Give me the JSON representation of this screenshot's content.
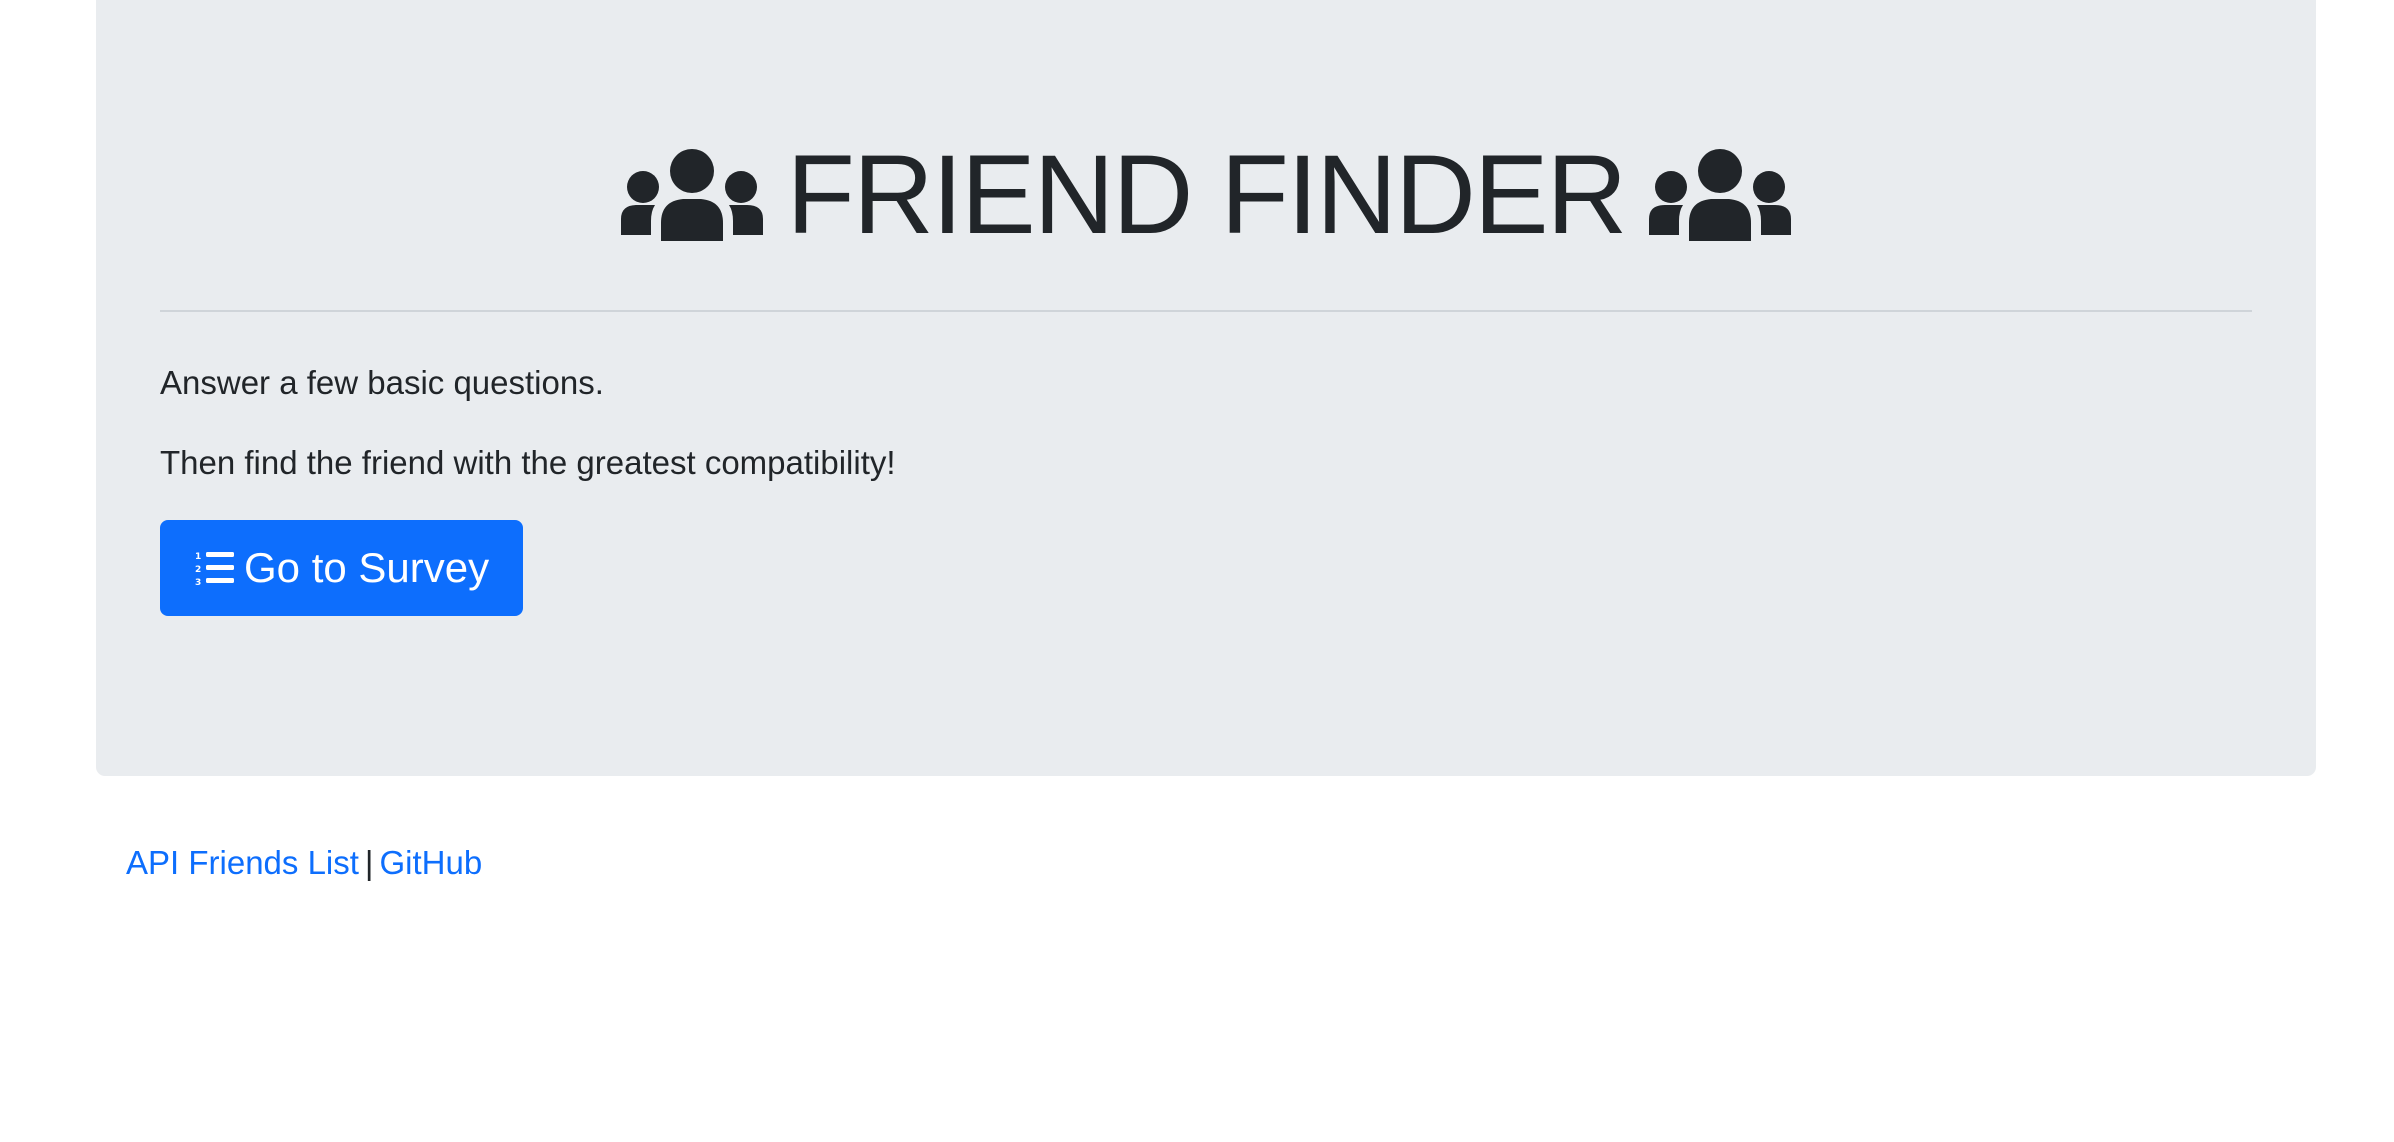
{
  "header": {
    "title": "FRIEND FINDER",
    "icon_left": "users-icon",
    "icon_right": "users-icon"
  },
  "main": {
    "line1": "Answer a few basic questions.",
    "line2": "Then find the friend with the greatest compatibility!",
    "survey_button": {
      "label": "Go to Survey",
      "icon": "list-ol-icon"
    }
  },
  "footer": {
    "api_link": "API Friends List",
    "separator": "|",
    "github_link": "GitHub"
  },
  "colors": {
    "jumbotron_bg": "#e9ecef",
    "primary": "#0d6efd",
    "text": "#212529"
  }
}
